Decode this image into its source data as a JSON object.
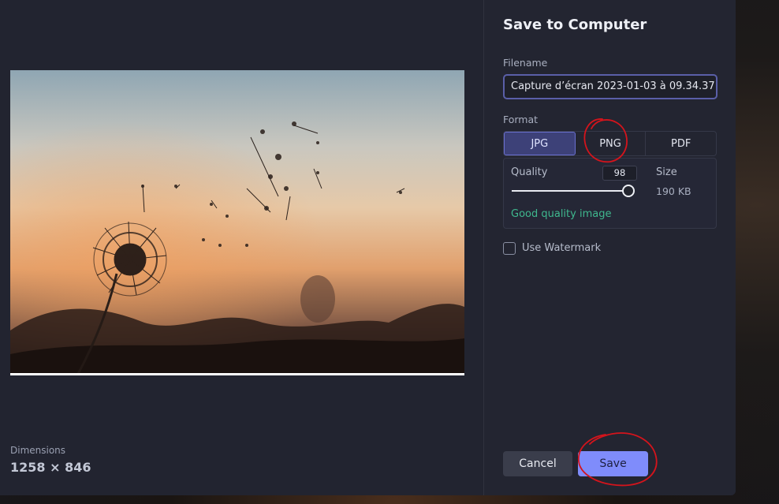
{
  "dialog": {
    "title": "Save to Computer",
    "filename_label": "Filename",
    "filename_value": "Capture d’écran 2023-01-03 à 09.34.37",
    "format_label": "Format",
    "formats": [
      "JPG",
      "PNG",
      "PDF"
    ],
    "selected_format": "JPG",
    "quality_label": "Quality",
    "quality_value": "98",
    "quality_level": 0.98,
    "size_label": "Size",
    "size_value": "190 KB",
    "quality_note": "Good quality image",
    "watermark_label": "Use Watermark",
    "watermark_checked": false,
    "cancel_label": "Cancel",
    "save_label": "Save"
  },
  "preview": {
    "subject": "dandelion-silhouette-sunset-photo",
    "dimensions_label": "Dimensions",
    "dimensions_value": "1258 × 846"
  },
  "colors": {
    "accent": "#7f8cfb",
    "selected_format_bg": "#3d4178",
    "quality_note": "#3fb88e",
    "annotation_red": "#d4141c",
    "panel_bg": "#232531"
  }
}
